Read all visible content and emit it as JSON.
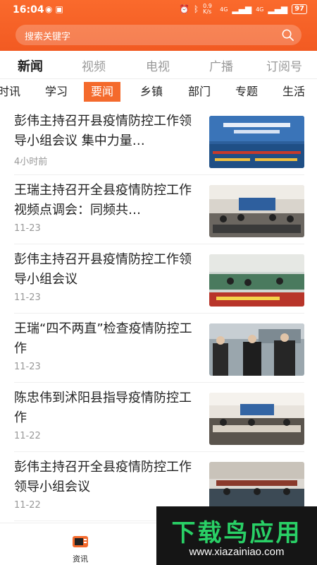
{
  "status_bar": {
    "time": "16:04",
    "network_speed": "0.9 K/s",
    "signal_label_1": "4G",
    "signal_label_2": "4G",
    "battery": "97"
  },
  "search": {
    "placeholder": "搜索关键字",
    "icon": "search-icon"
  },
  "main_tabs": [
    {
      "label": "新闻",
      "active": true
    },
    {
      "label": "视频",
      "active": false
    },
    {
      "label": "电视",
      "active": false
    },
    {
      "label": "广播",
      "active": false
    },
    {
      "label": "订阅号",
      "active": false
    }
  ],
  "sub_tabs": [
    {
      "label": "时讯",
      "active": false
    },
    {
      "label": "学习",
      "active": false
    },
    {
      "label": "要闻",
      "active": true
    },
    {
      "label": "乡镇",
      "active": false
    },
    {
      "label": "部门",
      "active": false
    },
    {
      "label": "专题",
      "active": false
    },
    {
      "label": "生活",
      "active": false
    }
  ],
  "news": [
    {
      "title": "彭伟主持召开县疫情防控工作领导小组会议 集中力量…",
      "time": "4小时前"
    },
    {
      "title": "王瑞主持召开全县疫情防控工作视频点调会：同频共…",
      "time": "11-23"
    },
    {
      "title": "彭伟主持召开县疫情防控工作领导小组会议",
      "time": "11-23"
    },
    {
      "title": "王瑞“四不两直”检查疫情防控工作",
      "time": "11-23"
    },
    {
      "title": "陈忠伟到沭阳县指导疫情防控工作",
      "time": "11-22"
    },
    {
      "title": "彭伟主持召开全县疫情防控工作领导小组会议",
      "time": "11-22"
    }
  ],
  "bottom_nav": {
    "label": "资讯",
    "icon": "news-icon"
  },
  "watermark": {
    "main": "下载鸟应用",
    "url": "www.xiazainiao.com"
  },
  "colors": {
    "accent": "#f46a2c",
    "header": "#f25a22",
    "watermark_green": "#29d066"
  }
}
